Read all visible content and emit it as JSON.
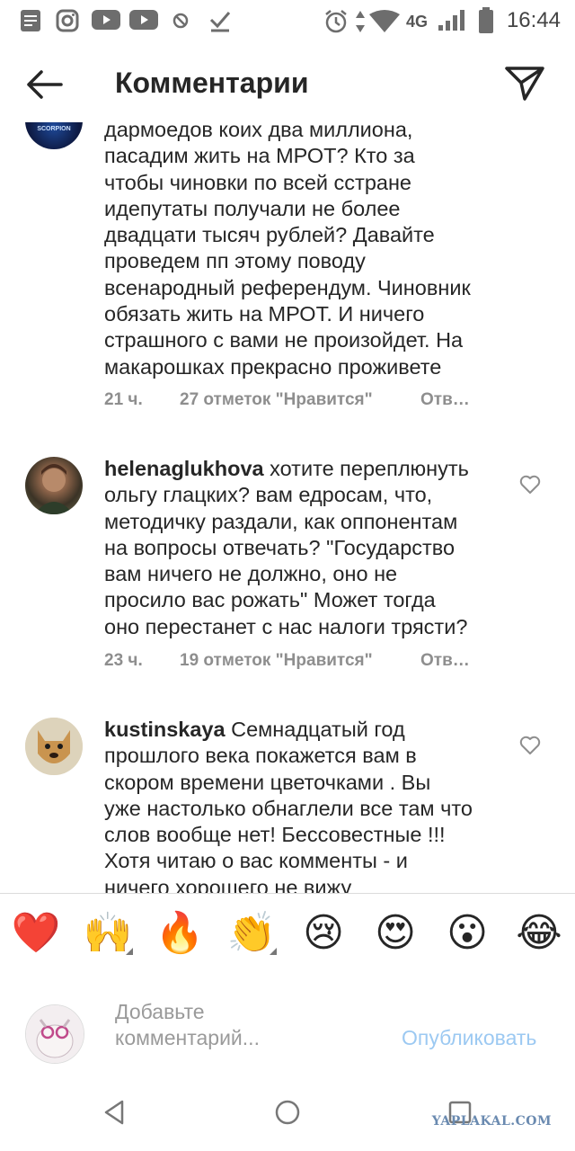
{
  "status_bar": {
    "time": "16:44",
    "network": "4G",
    "icons": [
      "notes-app-icon",
      "instagram-icon",
      "youtube-icon",
      "youtube-icon",
      "dnd-icon",
      "check-icon",
      "alarm-icon",
      "data-arrows-icon",
      "wifi-icon",
      "signal-icon",
      "battery-icon"
    ]
  },
  "header": {
    "title": "Комментарии",
    "back_icon": "back-arrow-icon",
    "send_icon": "send-icon"
  },
  "comments": [
    {
      "username": "",
      "text": "дармоедов коих два миллиона,\nпасадим жить на МРОТ? Кто за\nчтобы чиновки по всей сстране\nидепутаты получали не более\nдвадцати тысяч рублей? Давайте\nпроведем пп этому поводу\nвсенародный референдум. Чиновник\nобязать жить на МРОТ. И ничего\nстрашного с вами не произойдет. На\nмакарошках прекрасно проживете",
      "time": "21 ч.",
      "likes": "27 отметок \"Нравится\"",
      "reply": "Отв…",
      "avatar_text": "SCORPION"
    },
    {
      "username": "helenaglukhova",
      "text": " хотите переплюнуть\nольгу глацких? вам едросам, что,\nметодичку раздали, как оппонентам\nна вопросы отвечать? \"Государство\nвам ничего не должно, оно не\nпросило вас рожать\" Может тогда\nоно перестанет с нас налоги трясти?",
      "time": "23 ч.",
      "likes": "19 отметок \"Нравится\"",
      "reply": "Отв…"
    },
    {
      "username": "kustinskaya",
      "text": " Семнадцатый год\nпрошлого века покажется вам в\nскором времени цветочками . Вы\nуже настолько обнаглели все там что\nслов вообще нет! Бессовестные !!!\nХотя читаю о вас комменты - и\nничего хорошего не вижу"
    }
  ],
  "emoji_bar": [
    {
      "char": "❤️",
      "name": "red-heart-emoji",
      "has_variants": false
    },
    {
      "char": "🙌",
      "name": "raising-hands-emoji",
      "has_variants": true
    },
    {
      "char": "🔥",
      "name": "fire-emoji",
      "has_variants": false
    },
    {
      "char": "👏",
      "name": "clapping-hands-emoji",
      "has_variants": true
    },
    {
      "char": "😢",
      "name": "crying-face-emoji",
      "has_variants": false
    },
    {
      "char": "😍",
      "name": "heart-eyes-emoji",
      "has_variants": false
    },
    {
      "char": "😮",
      "name": "surprised-face-emoji",
      "has_variants": false
    },
    {
      "char": "😂",
      "name": "tears-of-joy-emoji",
      "has_variants": false
    }
  ],
  "composer": {
    "placeholder": "Добавьте\nкомментарий...",
    "publish_label": "Опубликовать"
  },
  "nav": {
    "back": "nav-back-icon",
    "home": "nav-home-icon",
    "recents": "nav-recents-icon"
  },
  "watermark": "YAPLAKAL.COM",
  "colors": {
    "text": "#262626",
    "meta": "#8e8e8e",
    "publish_disabled": "#9cc9f2",
    "heart": "#d41f25"
  }
}
